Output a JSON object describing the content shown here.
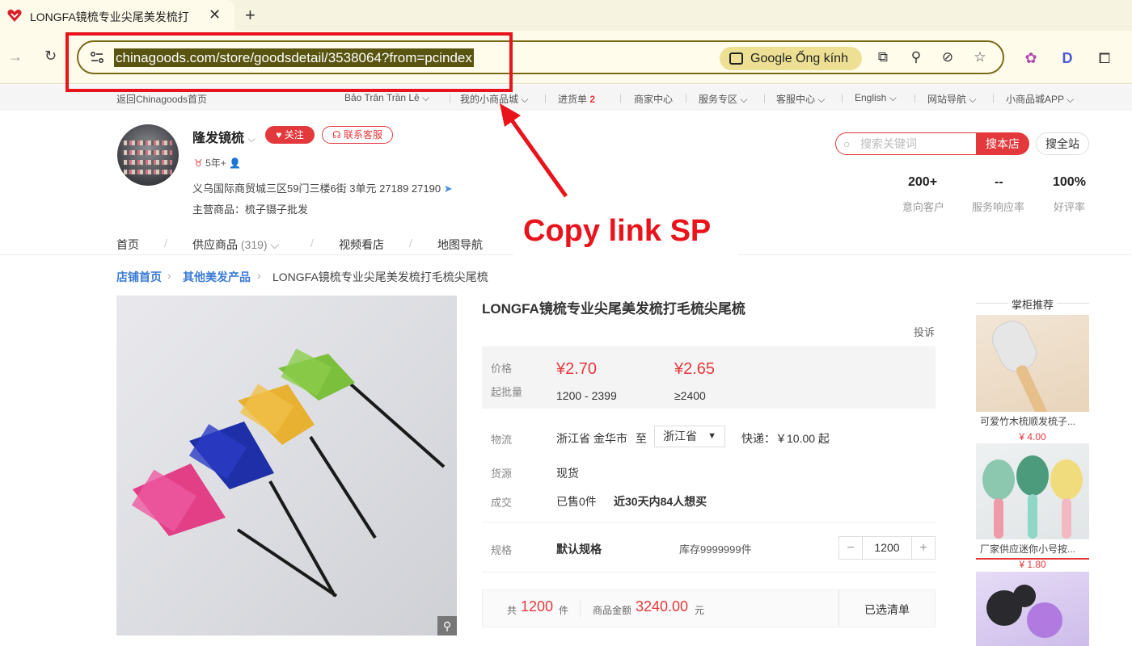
{
  "browser": {
    "tab_title": "LONGFA镜梳专业尖尾美发梳打",
    "url": "chinagoods.com/store/goodsdetail/3538064?from=pcindex",
    "lens_label": "Google Ống kính"
  },
  "site_nav": {
    "back_home": "返回Chinagoods首页",
    "user": "Bảo Trân Trần Lê",
    "my_mall": "我的小商品城",
    "cart_label": "进货单",
    "cart_count": "2",
    "merchant": "商家中心",
    "service_zone": "服务专区",
    "customer_service": "客服中心",
    "language": "English",
    "site_nav": "网站导航",
    "app": "小商品城APP"
  },
  "store": {
    "name": "隆发镜梳",
    "follow": "关注",
    "contact": "联系客服",
    "years": "5年+",
    "address": "义乌国际商贸城三区59门三楼6街 3单元 27189 27190",
    "main_products": "主营商品：梳子镊子批发",
    "search_placeholder": "搜索关键词",
    "search_store": "搜本店",
    "search_site": "搜全站",
    "stats": [
      {
        "value": "200+",
        "label": "意向客户"
      },
      {
        "value": "--",
        "label": "服务响应率"
      },
      {
        "value": "100%",
        "label": "好评率"
      }
    ],
    "nav": {
      "home": "首页",
      "products": "供应商品",
      "products_count": "(319)",
      "video": "视频看店",
      "map": "地图导航"
    }
  },
  "annotation": "Copy link SP",
  "breadcrumb": {
    "home": "店铺首页",
    "category": "其他美发产品",
    "current": "LONGFA镜梳专业尖尾美发梳打毛梳尖尾梳"
  },
  "product": {
    "title": "LONGFA镜梳专业尖尾美发梳打毛梳尖尾梳",
    "report": "投诉",
    "price_label": "价格",
    "moq_label": "起批量",
    "tiers": [
      {
        "price": "¥2.70",
        "range": "1200 - 2399"
      },
      {
        "price": "¥2.65",
        "range": "≥2400"
      }
    ],
    "logistics_label": "物流",
    "origin": "浙江省 金华市",
    "to": "至",
    "destination": "浙江省",
    "shipping": "快递：￥10.00 起",
    "source_label": "货源",
    "source": "现货",
    "deal_label": "成交",
    "sold": "已售0件",
    "wanted": "近30天内84人想买",
    "spec_label": "规格",
    "spec_value": "默认规格",
    "stock": "库存9999999件",
    "qty": "1200",
    "total_prefix": "共",
    "total_qty": "1200",
    "total_unit": "件",
    "amount_label": "商品金额",
    "amount": "3240.00",
    "amount_unit": "元",
    "selected_list": "已选清单"
  },
  "recommend": {
    "title": "掌柜推荐",
    "items": [
      {
        "name": "可爱竹木梳顺发梳子...",
        "price": "¥ 4.00"
      },
      {
        "name": "厂家供应迷你小号按...",
        "price": "¥ 1.80"
      }
    ]
  }
}
